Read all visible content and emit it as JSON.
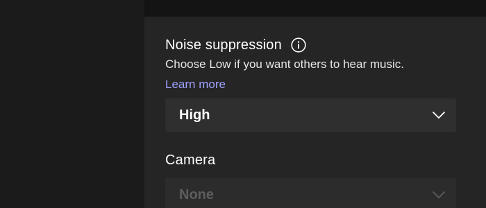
{
  "settings": {
    "noise_suppression": {
      "title": "Noise suppression",
      "info_icon": "info-circle-icon",
      "description": "Choose Low if you want others to hear music.",
      "learn_more": "Learn more",
      "selected": "High",
      "chevron_icon": "chevron-down-icon"
    },
    "camera": {
      "title": "Camera",
      "selected": "None",
      "state": "disabled",
      "chevron_icon": "chevron-down-icon"
    }
  },
  "colors": {
    "background": "#252525",
    "left_rail": "#1b1b1b",
    "top_bar": "#141414",
    "dropdown": "#2f2f2f",
    "link": "#9ea2ff",
    "text": "#ffffff",
    "disabled_text": "#5e5e5e"
  }
}
